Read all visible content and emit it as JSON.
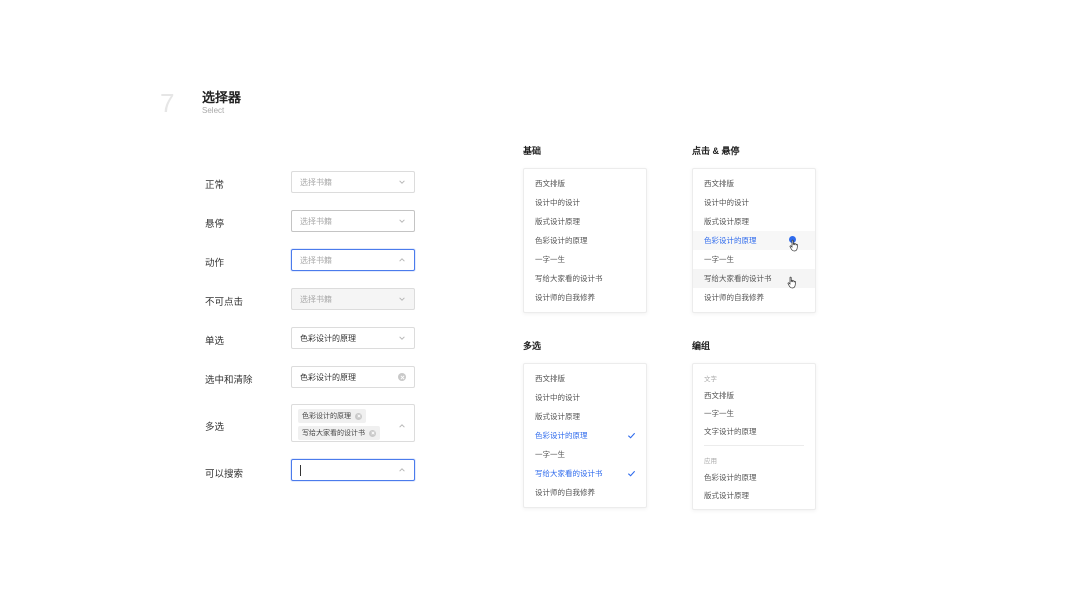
{
  "section": {
    "number": "7",
    "title": "选择器",
    "subtitle": "Select"
  },
  "rows": {
    "normal": {
      "label": "正常",
      "value": "选择书籍"
    },
    "hover": {
      "label": "悬停",
      "value": "选择书籍"
    },
    "action": {
      "label": "动作",
      "value": "选择书籍"
    },
    "disabled": {
      "label": "不可点击",
      "value": "选择书籍"
    },
    "single": {
      "label": "单选",
      "value": "色彩设计的原理"
    },
    "clearable": {
      "label": "选中和清除",
      "value": "色彩设计的原理"
    },
    "multiple": {
      "label": "多选",
      "tags": [
        "色彩设计的原理",
        "写给大家看的设计书"
      ]
    },
    "searchable": {
      "label": "可以搜索",
      "value": ""
    }
  },
  "panels": {
    "basic": {
      "title": "基础",
      "items": [
        "西文排版",
        "设计中的设计",
        "版式设计原理",
        "色彩设计的原理",
        "一字一生",
        "写给大家看的设计书",
        "设计师的自我修养"
      ]
    },
    "click_hover": {
      "title": "点击 & 悬停",
      "items": [
        "西文排版",
        "设计中的设计",
        "版式设计原理",
        "色彩设计的原理",
        "一字一生",
        "写给大家看的设计书",
        "设计师的自我修养"
      ]
    },
    "multi": {
      "title": "多选",
      "items": [
        "西文排版",
        "设计中的设计",
        "版式设计原理",
        "色彩设计的原理",
        "一字一生",
        "写给大家看的设计书",
        "设计师的自我修养"
      ]
    },
    "grouped": {
      "title": "编组",
      "groups": [
        {
          "label": "文字",
          "items": [
            "西文排版",
            "一字一生",
            "文字设计的原理"
          ]
        },
        {
          "label": "应用",
          "items": [
            "色彩设计的原理",
            "版式设计原理"
          ]
        }
      ]
    }
  },
  "colors": {
    "accent": "#2f6bed",
    "border": "#dcdcdc",
    "placeholder": "#a9a9a9"
  }
}
